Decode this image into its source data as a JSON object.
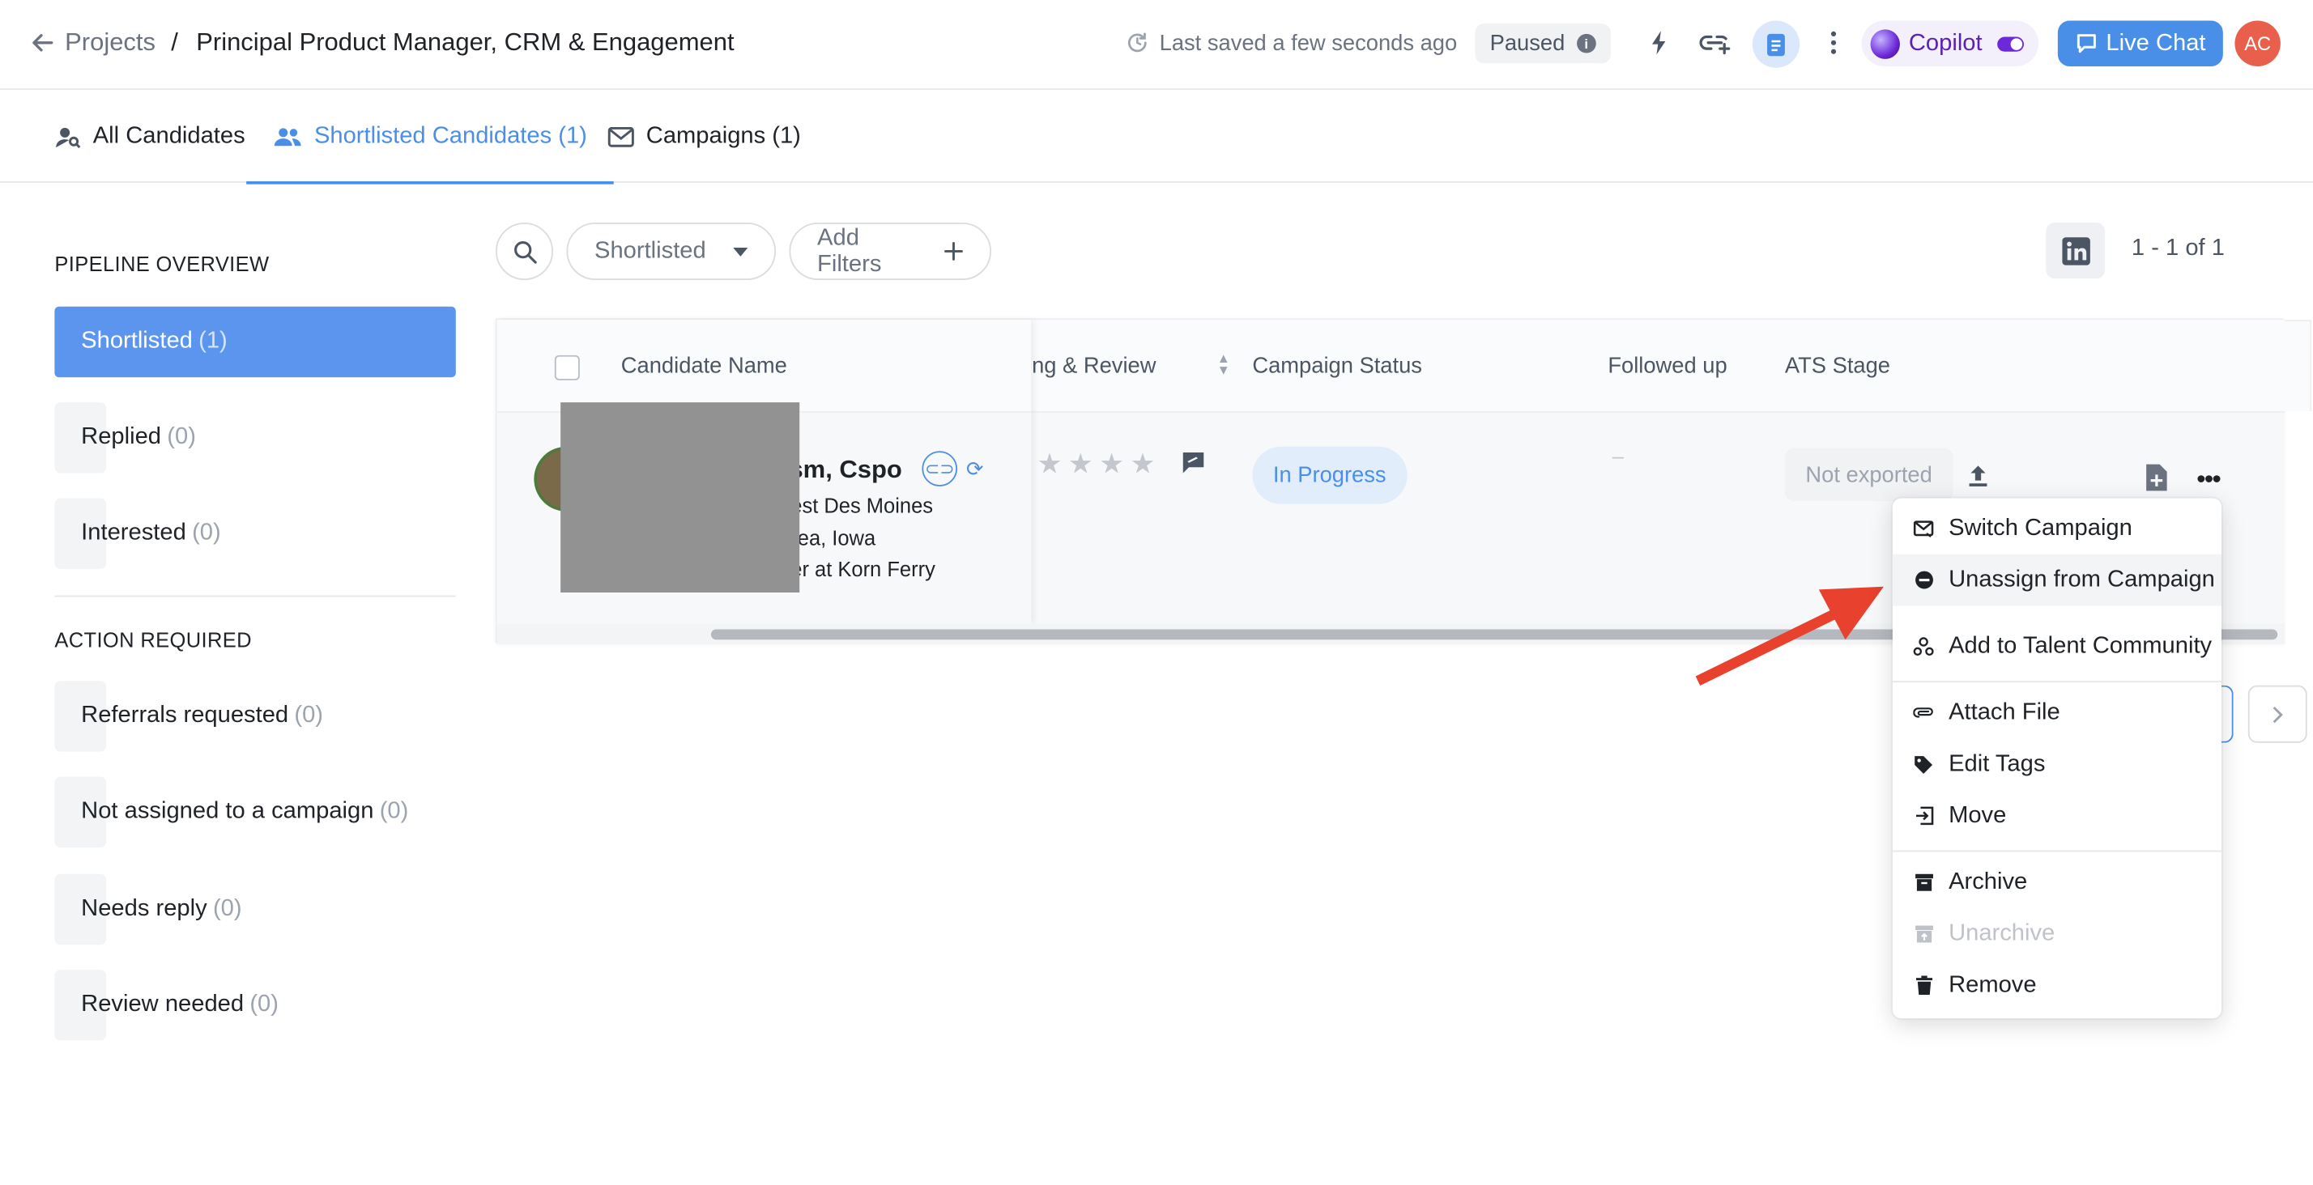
{
  "header": {
    "breadcrumb_root": "Projects",
    "breadcrumb_sep": "/",
    "title": "Principal Product Manager, CRM & Engagement",
    "saved_status": "Last saved a few seconds ago",
    "paused_label": "Paused",
    "copilot_label": "Copilot",
    "live_chat_label": "Live Chat",
    "avatar_initials": "AC"
  },
  "tabs": [
    {
      "label": "All Candidates",
      "icon": "person-search-icon"
    },
    {
      "label": "Shortlisted Candidates (1)",
      "icon": "people-icon",
      "active": true
    },
    {
      "label": "Campaigns (1)",
      "icon": "mail-icon"
    }
  ],
  "sidebar": {
    "pipeline_heading": "PIPELINE OVERVIEW",
    "pipeline_items": [
      {
        "label": "Shortlisted",
        "count": "(1)",
        "active": true
      },
      {
        "label": "Replied",
        "count": "(0)"
      },
      {
        "label": "Interested",
        "count": "(0)"
      }
    ],
    "action_heading": "ACTION REQUIRED",
    "action_items": [
      {
        "label": "Referrals requested",
        "count": "(0)"
      },
      {
        "label": "Not assigned to a campaign",
        "count": "(0)"
      },
      {
        "label": "Needs reply",
        "count": "(0)"
      },
      {
        "label": "Review needed",
        "count": "(0)"
      }
    ]
  },
  "toolbar": {
    "stage_filter": "Shortlisted",
    "add_filters": "Add Filters",
    "pagination": "1 - 1 of 1"
  },
  "table": {
    "columns": {
      "candidate_name": "Candidate Name",
      "rating_review": "ting & Review",
      "campaign_status": "Campaign Status",
      "followed_up": "Followed up",
      "ats_stage": "ATS Stage"
    },
    "row": {
      "name_fragment": "sm, Cspo",
      "line1": "est Des Moines",
      "line2": "rea, Iowa",
      "line3": "er at Korn Ferry",
      "rating_stars": 0,
      "campaign_status": "In Progress",
      "followed_up": "–",
      "ats_stage": "Not exported"
    }
  },
  "menu": {
    "items": [
      {
        "label": "Switch Campaign",
        "icon": "switch-campaign-icon"
      },
      {
        "label": "Unassign from Campaign",
        "icon": "minus-circle-icon"
      },
      {
        "label": "Add to Talent Community",
        "icon": "community-icon"
      },
      {
        "label": "Attach File",
        "icon": "paperclip-icon"
      },
      {
        "label": "Edit Tags",
        "icon": "tag-icon"
      },
      {
        "label": "Move",
        "icon": "move-icon"
      },
      {
        "label": "Archive",
        "icon": "archive-icon"
      },
      {
        "label": "Unarchive",
        "icon": "unarchive-icon",
        "disabled": true
      },
      {
        "label": "Remove",
        "icon": "trash-icon"
      }
    ]
  },
  "colors": {
    "accent": "#4a8fe7",
    "sidebar_active": "#5b95ee",
    "annotation_arrow": "#e8412e"
  }
}
